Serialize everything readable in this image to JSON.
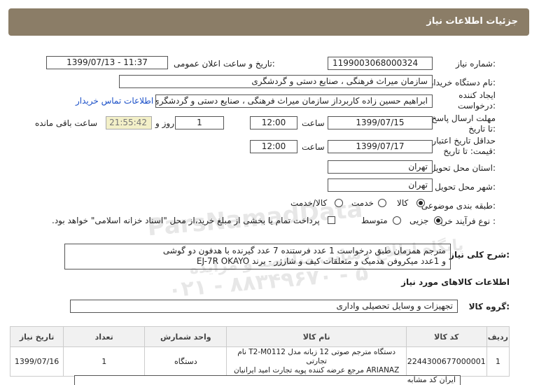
{
  "header": {
    "title": "جزئیات اطلاعات نیاز"
  },
  "labels": {
    "need_number": "شماره نیاز:",
    "announce_datetime": "تاریخ و ساعت اعلان عمومی:",
    "buyer_org": "نام دستگاه خریدار:",
    "requester": "ایجاد کننده درخواست:",
    "deadline": "مهلت ارسال پاسخ: تا تاریخ:",
    "hour": "ساعت",
    "day_and": "روز و",
    "remaining": "ساعت باقی مانده",
    "validity": "حداقل تاریخ اعتبار قیمت: تا تاریخ:",
    "province": "استان محل تحویل:",
    "city": "شهر محل تحویل:",
    "category": "طبقه بندی موضوعی:",
    "process": "نوع فرآیند خرید :",
    "description": "شرح کلی نیاز:",
    "goods_info": "اطلاعات کالاهای مورد نیاز",
    "goods_group": "گروه کالا:"
  },
  "fields": {
    "need_number": "1199003068000324",
    "announce_datetime": "1399/07/13 - 11:37",
    "buyer_org": "سازمان میراث فرهنگی ، صنایع دستی و گردشگری",
    "requester": "ابراهیم حسین زاده کاربرداز سازمان میراث فرهنگی ، صنایع دستی و گردشگری",
    "contact_link": "اطلاعات تماس خریدار",
    "deadline_date": "1399/07/15",
    "deadline_time": "12:00",
    "days": "1",
    "remaining_time": "21:55:42",
    "validity_date": "1399/07/17",
    "validity_time": "12:00",
    "province": "تهران",
    "city": "تهران",
    "goods_group": "تجهیزات و وسایل تحصیلی واداری"
  },
  "category_options": [
    "کالا",
    "خدمت",
    "کالا/خدمت"
  ],
  "process_options": [
    "جزیی",
    "متوسط"
  ],
  "payment_note": "پرداخت تمام یا بخشی از مبلغ خرید،از محل \"اسناد خزانه اسلامی\" خواهد بود.",
  "description": {
    "line1": "مترجم همزمان طبق درخواست 1 عدد فرستنده 7 عدد گیرنده با هدفون دو گوشی",
    "line2": "و 1عدد میکروفن هدمیک و متعلقات کیف و شارژر - برند  EJ-7R  OKAYO"
  },
  "table": {
    "headers": [
      "ردیف",
      "کد کالا",
      "نام کالا",
      "واحد شمارش",
      "تعداد",
      "تاریخ نیاز"
    ],
    "rows": [
      {
        "row": "1",
        "code": "2244300677000001",
        "name_line1": "دستگاه مترجم صوتی 12 زبانه مدل T2-M0112 نام تجارتی",
        "name_line2": "ARIANAZ مرجع عرضه کننده پویه تجارت امید ایرانیان",
        "unit": "دستگاه",
        "qty": "1",
        "date": "1399/07/16"
      }
    ]
  },
  "bottom_box": "ایران کد مشابه",
  "watermark": {
    "brand": "ParsNamadData",
    "line1": "پایگاه اطلاع رسانی مناقصه و مزایده",
    "phone": "۰۲۱ - ۸۸۳۴۹۶۷۰ - ۵"
  }
}
